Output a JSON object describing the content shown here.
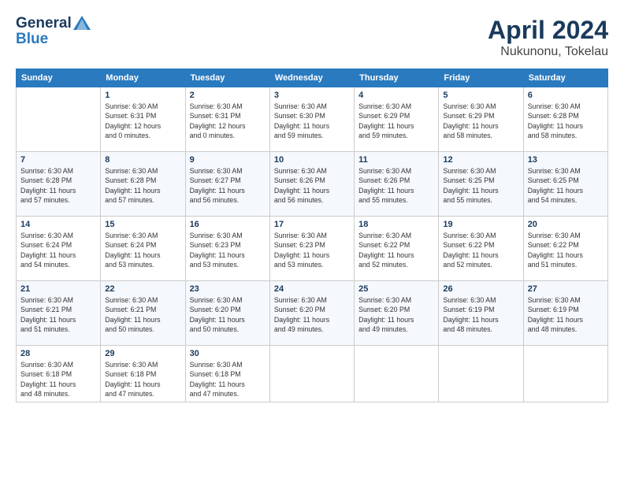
{
  "header": {
    "logo_line1": "General",
    "logo_line2": "Blue",
    "month": "April 2024",
    "location": "Nukunonu, Tokelau"
  },
  "weekdays": [
    "Sunday",
    "Monday",
    "Tuesday",
    "Wednesday",
    "Thursday",
    "Friday",
    "Saturday"
  ],
  "weeks": [
    [
      {
        "day": "",
        "info": ""
      },
      {
        "day": "1",
        "info": "Sunrise: 6:30 AM\nSunset: 6:31 PM\nDaylight: 12 hours\nand 0 minutes."
      },
      {
        "day": "2",
        "info": "Sunrise: 6:30 AM\nSunset: 6:31 PM\nDaylight: 12 hours\nand 0 minutes."
      },
      {
        "day": "3",
        "info": "Sunrise: 6:30 AM\nSunset: 6:30 PM\nDaylight: 11 hours\nand 59 minutes."
      },
      {
        "day": "4",
        "info": "Sunrise: 6:30 AM\nSunset: 6:29 PM\nDaylight: 11 hours\nand 59 minutes."
      },
      {
        "day": "5",
        "info": "Sunrise: 6:30 AM\nSunset: 6:29 PM\nDaylight: 11 hours\nand 58 minutes."
      },
      {
        "day": "6",
        "info": "Sunrise: 6:30 AM\nSunset: 6:28 PM\nDaylight: 11 hours\nand 58 minutes."
      }
    ],
    [
      {
        "day": "7",
        "info": "Sunrise: 6:30 AM\nSunset: 6:28 PM\nDaylight: 11 hours\nand 57 minutes."
      },
      {
        "day": "8",
        "info": "Sunrise: 6:30 AM\nSunset: 6:28 PM\nDaylight: 11 hours\nand 57 minutes."
      },
      {
        "day": "9",
        "info": "Sunrise: 6:30 AM\nSunset: 6:27 PM\nDaylight: 11 hours\nand 56 minutes."
      },
      {
        "day": "10",
        "info": "Sunrise: 6:30 AM\nSunset: 6:26 PM\nDaylight: 11 hours\nand 56 minutes."
      },
      {
        "day": "11",
        "info": "Sunrise: 6:30 AM\nSunset: 6:26 PM\nDaylight: 11 hours\nand 55 minutes."
      },
      {
        "day": "12",
        "info": "Sunrise: 6:30 AM\nSunset: 6:25 PM\nDaylight: 11 hours\nand 55 minutes."
      },
      {
        "day": "13",
        "info": "Sunrise: 6:30 AM\nSunset: 6:25 PM\nDaylight: 11 hours\nand 54 minutes."
      }
    ],
    [
      {
        "day": "14",
        "info": "Sunrise: 6:30 AM\nSunset: 6:24 PM\nDaylight: 11 hours\nand 54 minutes."
      },
      {
        "day": "15",
        "info": "Sunrise: 6:30 AM\nSunset: 6:24 PM\nDaylight: 11 hours\nand 53 minutes."
      },
      {
        "day": "16",
        "info": "Sunrise: 6:30 AM\nSunset: 6:23 PM\nDaylight: 11 hours\nand 53 minutes."
      },
      {
        "day": "17",
        "info": "Sunrise: 6:30 AM\nSunset: 6:23 PM\nDaylight: 11 hours\nand 53 minutes."
      },
      {
        "day": "18",
        "info": "Sunrise: 6:30 AM\nSunset: 6:22 PM\nDaylight: 11 hours\nand 52 minutes."
      },
      {
        "day": "19",
        "info": "Sunrise: 6:30 AM\nSunset: 6:22 PM\nDaylight: 11 hours\nand 52 minutes."
      },
      {
        "day": "20",
        "info": "Sunrise: 6:30 AM\nSunset: 6:22 PM\nDaylight: 11 hours\nand 51 minutes."
      }
    ],
    [
      {
        "day": "21",
        "info": "Sunrise: 6:30 AM\nSunset: 6:21 PM\nDaylight: 11 hours\nand 51 minutes."
      },
      {
        "day": "22",
        "info": "Sunrise: 6:30 AM\nSunset: 6:21 PM\nDaylight: 11 hours\nand 50 minutes."
      },
      {
        "day": "23",
        "info": "Sunrise: 6:30 AM\nSunset: 6:20 PM\nDaylight: 11 hours\nand 50 minutes."
      },
      {
        "day": "24",
        "info": "Sunrise: 6:30 AM\nSunset: 6:20 PM\nDaylight: 11 hours\nand 49 minutes."
      },
      {
        "day": "25",
        "info": "Sunrise: 6:30 AM\nSunset: 6:20 PM\nDaylight: 11 hours\nand 49 minutes."
      },
      {
        "day": "26",
        "info": "Sunrise: 6:30 AM\nSunset: 6:19 PM\nDaylight: 11 hours\nand 48 minutes."
      },
      {
        "day": "27",
        "info": "Sunrise: 6:30 AM\nSunset: 6:19 PM\nDaylight: 11 hours\nand 48 minutes."
      }
    ],
    [
      {
        "day": "28",
        "info": "Sunrise: 6:30 AM\nSunset: 6:18 PM\nDaylight: 11 hours\nand 48 minutes."
      },
      {
        "day": "29",
        "info": "Sunrise: 6:30 AM\nSunset: 6:18 PM\nDaylight: 11 hours\nand 47 minutes."
      },
      {
        "day": "30",
        "info": "Sunrise: 6:30 AM\nSunset: 6:18 PM\nDaylight: 11 hours\nand 47 minutes."
      },
      {
        "day": "",
        "info": ""
      },
      {
        "day": "",
        "info": ""
      },
      {
        "day": "",
        "info": ""
      },
      {
        "day": "",
        "info": ""
      }
    ]
  ]
}
